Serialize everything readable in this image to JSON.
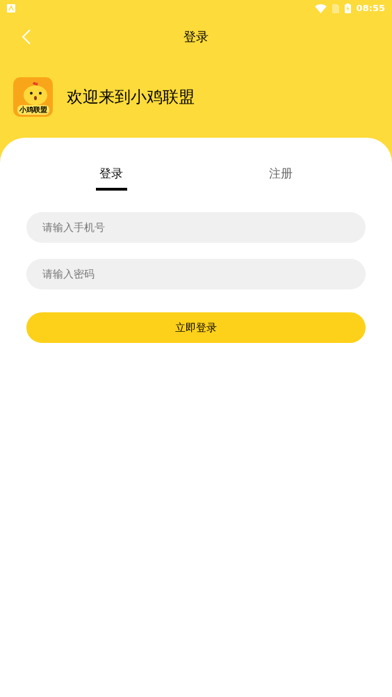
{
  "status_bar": {
    "time": "08:55"
  },
  "header": {
    "title": "登录"
  },
  "welcome": {
    "logo_text": "小鸡联盟",
    "text": "欢迎来到小鸡联盟"
  },
  "tabs": [
    {
      "label": "登录",
      "selected": true
    },
    {
      "label": "注册",
      "selected": false
    }
  ],
  "fields": [
    {
      "placeholder": "请输入手机号"
    },
    {
      "placeholder": "请输入密码"
    }
  ],
  "submit": "立即登录"
}
